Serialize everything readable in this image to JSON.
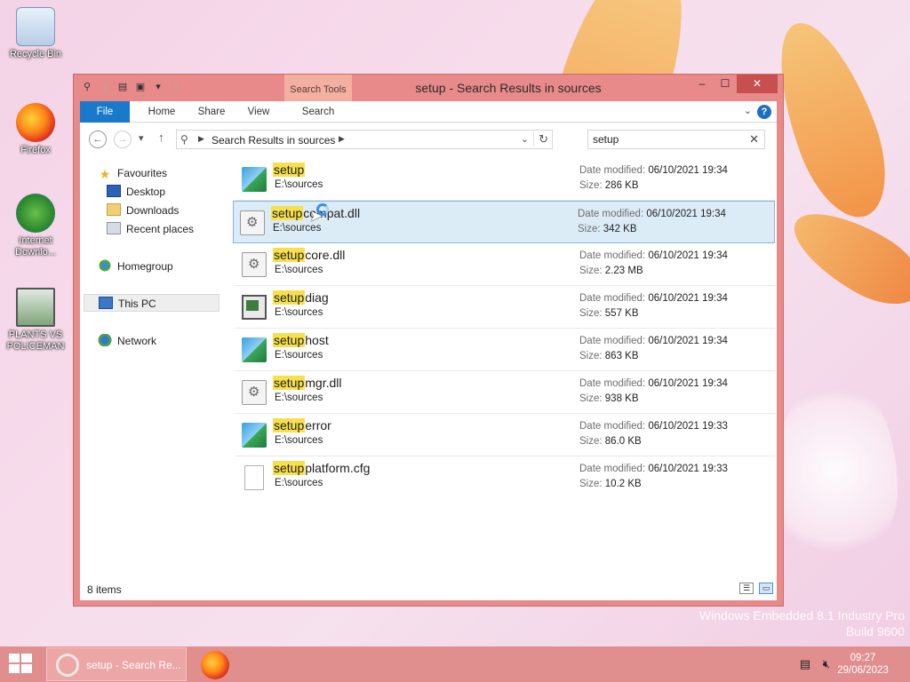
{
  "desktop": {
    "icons": [
      {
        "label": "Recycle Bin",
        "icon": "recycle-bin-icon"
      },
      {
        "label": "Firefox",
        "icon": "firefox-icon"
      },
      {
        "label": "Internet Downlo...",
        "icon": "idm-icon"
      },
      {
        "label": "PLANTS VS POLICEMAN",
        "icon": "game-icon"
      }
    ],
    "watermark_line1": "Windows Embedded 8.1 Industry Pro",
    "watermark_line2": "Build 9600"
  },
  "window": {
    "title": "setup - Search Results in sources",
    "contextual_tab": "Search Tools",
    "accent_color": "#e98a8a",
    "caption": {
      "minimize": "–",
      "maximize": "☐",
      "close": "✕"
    }
  },
  "ribbon": {
    "tabs": [
      "File",
      "Home",
      "Share",
      "View",
      "Search"
    ],
    "help": "?"
  },
  "address": {
    "breadcrumb": "Search Results in sources",
    "search_value": "setup"
  },
  "nav": {
    "favourites": "Favourites",
    "desktop": "Desktop",
    "downloads": "Downloads",
    "recent": "Recent places",
    "homegroup": "Homegroup",
    "this_pc": "This PC",
    "network": "Network"
  },
  "files": [
    {
      "match": "setup",
      "rest": "",
      "location": "E:\\sources",
      "date_label": "Date modified:",
      "date": "06/10/2021 19:34",
      "size_label": "Size:",
      "size": "286 KB",
      "icon": "setup-exe-icon"
    },
    {
      "match": "setup",
      "rest": "compat.dll",
      "location": "E:\\sources",
      "date_label": "Date modified:",
      "date": "06/10/2021 19:34",
      "size_label": "Size:",
      "size": "342 KB",
      "icon": "dll-icon"
    },
    {
      "match": "setup",
      "rest": "core.dll",
      "location": "E:\\sources",
      "date_label": "Date modified:",
      "date": "06/10/2021 19:34",
      "size_label": "Size:",
      "size": "2.23 MB",
      "icon": "dll-icon"
    },
    {
      "match": "setup",
      "rest": "diag",
      "location": "E:\\sources",
      "date_label": "Date modified:",
      "date": "06/10/2021 19:34",
      "size_label": "Size:",
      "size": "557 KB",
      "icon": "app-window-icon"
    },
    {
      "match": "setup",
      "rest": "host",
      "location": "E:\\sources",
      "date_label": "Date modified:",
      "date": "06/10/2021 19:34",
      "size_label": "Size:",
      "size": "863 KB",
      "icon": "setup-exe-icon"
    },
    {
      "match": "setup",
      "rest": "mgr.dll",
      "location": "E:\\sources",
      "date_label": "Date modified:",
      "date": "06/10/2021 19:34",
      "size_label": "Size:",
      "size": "938 KB",
      "icon": "dll-icon"
    },
    {
      "match": "setup",
      "rest": "error",
      "location": "E:\\sources",
      "date_label": "Date modified:",
      "date": "06/10/2021 19:33",
      "size_label": "Size:",
      "size": "86.0 KB",
      "icon": "setup-exe-icon"
    },
    {
      "match": "setup",
      "rest": "platform.cfg",
      "location": "E:\\sources",
      "date_label": "Date modified:",
      "date": "06/10/2021 19:33",
      "size_label": "Size:",
      "size": "10.2 KB",
      "icon": "blank-file-icon"
    }
  ],
  "status": {
    "item_count": "8 items"
  },
  "taskbar": {
    "task_label": "setup - Search Re...",
    "time": "09:27",
    "date": "29/06/2023",
    "taskbar_color": "#e08e8e"
  }
}
